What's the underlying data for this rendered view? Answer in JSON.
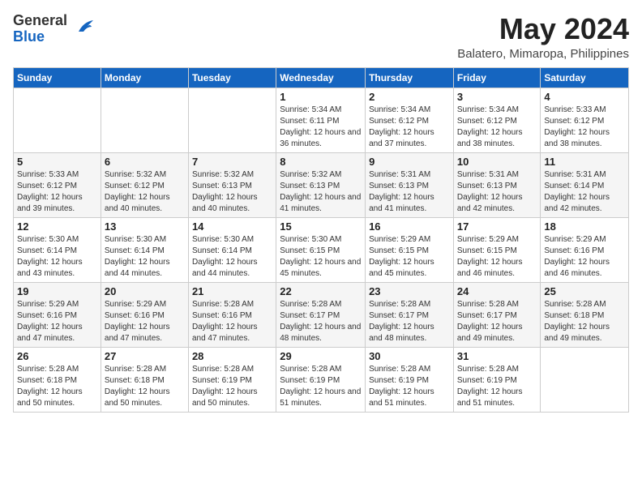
{
  "logo": {
    "general": "General",
    "blue": "Blue"
  },
  "title": "May 2024",
  "location": "Balatero, Mimaropa, Philippines",
  "days_of_week": [
    "Sunday",
    "Monday",
    "Tuesday",
    "Wednesday",
    "Thursday",
    "Friday",
    "Saturday"
  ],
  "weeks": [
    [
      {
        "day": "",
        "sunrise": "",
        "sunset": "",
        "daylight": ""
      },
      {
        "day": "",
        "sunrise": "",
        "sunset": "",
        "daylight": ""
      },
      {
        "day": "",
        "sunrise": "",
        "sunset": "",
        "daylight": ""
      },
      {
        "day": "1",
        "sunrise": "Sunrise: 5:34 AM",
        "sunset": "Sunset: 6:11 PM",
        "daylight": "Daylight: 12 hours and 36 minutes."
      },
      {
        "day": "2",
        "sunrise": "Sunrise: 5:34 AM",
        "sunset": "Sunset: 6:12 PM",
        "daylight": "Daylight: 12 hours and 37 minutes."
      },
      {
        "day": "3",
        "sunrise": "Sunrise: 5:34 AM",
        "sunset": "Sunset: 6:12 PM",
        "daylight": "Daylight: 12 hours and 38 minutes."
      },
      {
        "day": "4",
        "sunrise": "Sunrise: 5:33 AM",
        "sunset": "Sunset: 6:12 PM",
        "daylight": "Daylight: 12 hours and 38 minutes."
      }
    ],
    [
      {
        "day": "5",
        "sunrise": "Sunrise: 5:33 AM",
        "sunset": "Sunset: 6:12 PM",
        "daylight": "Daylight: 12 hours and 39 minutes."
      },
      {
        "day": "6",
        "sunrise": "Sunrise: 5:32 AM",
        "sunset": "Sunset: 6:12 PM",
        "daylight": "Daylight: 12 hours and 40 minutes."
      },
      {
        "day": "7",
        "sunrise": "Sunrise: 5:32 AM",
        "sunset": "Sunset: 6:13 PM",
        "daylight": "Daylight: 12 hours and 40 minutes."
      },
      {
        "day": "8",
        "sunrise": "Sunrise: 5:32 AM",
        "sunset": "Sunset: 6:13 PM",
        "daylight": "Daylight: 12 hours and 41 minutes."
      },
      {
        "day": "9",
        "sunrise": "Sunrise: 5:31 AM",
        "sunset": "Sunset: 6:13 PM",
        "daylight": "Daylight: 12 hours and 41 minutes."
      },
      {
        "day": "10",
        "sunrise": "Sunrise: 5:31 AM",
        "sunset": "Sunset: 6:13 PM",
        "daylight": "Daylight: 12 hours and 42 minutes."
      },
      {
        "day": "11",
        "sunrise": "Sunrise: 5:31 AM",
        "sunset": "Sunset: 6:14 PM",
        "daylight": "Daylight: 12 hours and 42 minutes."
      }
    ],
    [
      {
        "day": "12",
        "sunrise": "Sunrise: 5:30 AM",
        "sunset": "Sunset: 6:14 PM",
        "daylight": "Daylight: 12 hours and 43 minutes."
      },
      {
        "day": "13",
        "sunrise": "Sunrise: 5:30 AM",
        "sunset": "Sunset: 6:14 PM",
        "daylight": "Daylight: 12 hours and 44 minutes."
      },
      {
        "day": "14",
        "sunrise": "Sunrise: 5:30 AM",
        "sunset": "Sunset: 6:14 PM",
        "daylight": "Daylight: 12 hours and 44 minutes."
      },
      {
        "day": "15",
        "sunrise": "Sunrise: 5:30 AM",
        "sunset": "Sunset: 6:15 PM",
        "daylight": "Daylight: 12 hours and 45 minutes."
      },
      {
        "day": "16",
        "sunrise": "Sunrise: 5:29 AM",
        "sunset": "Sunset: 6:15 PM",
        "daylight": "Daylight: 12 hours and 45 minutes."
      },
      {
        "day": "17",
        "sunrise": "Sunrise: 5:29 AM",
        "sunset": "Sunset: 6:15 PM",
        "daylight": "Daylight: 12 hours and 46 minutes."
      },
      {
        "day": "18",
        "sunrise": "Sunrise: 5:29 AM",
        "sunset": "Sunset: 6:16 PM",
        "daylight": "Daylight: 12 hours and 46 minutes."
      }
    ],
    [
      {
        "day": "19",
        "sunrise": "Sunrise: 5:29 AM",
        "sunset": "Sunset: 6:16 PM",
        "daylight": "Daylight: 12 hours and 47 minutes."
      },
      {
        "day": "20",
        "sunrise": "Sunrise: 5:29 AM",
        "sunset": "Sunset: 6:16 PM",
        "daylight": "Daylight: 12 hours and 47 minutes."
      },
      {
        "day": "21",
        "sunrise": "Sunrise: 5:28 AM",
        "sunset": "Sunset: 6:16 PM",
        "daylight": "Daylight: 12 hours and 47 minutes."
      },
      {
        "day": "22",
        "sunrise": "Sunrise: 5:28 AM",
        "sunset": "Sunset: 6:17 PM",
        "daylight": "Daylight: 12 hours and 48 minutes."
      },
      {
        "day": "23",
        "sunrise": "Sunrise: 5:28 AM",
        "sunset": "Sunset: 6:17 PM",
        "daylight": "Daylight: 12 hours and 48 minutes."
      },
      {
        "day": "24",
        "sunrise": "Sunrise: 5:28 AM",
        "sunset": "Sunset: 6:17 PM",
        "daylight": "Daylight: 12 hours and 49 minutes."
      },
      {
        "day": "25",
        "sunrise": "Sunrise: 5:28 AM",
        "sunset": "Sunset: 6:18 PM",
        "daylight": "Daylight: 12 hours and 49 minutes."
      }
    ],
    [
      {
        "day": "26",
        "sunrise": "Sunrise: 5:28 AM",
        "sunset": "Sunset: 6:18 PM",
        "daylight": "Daylight: 12 hours and 50 minutes."
      },
      {
        "day": "27",
        "sunrise": "Sunrise: 5:28 AM",
        "sunset": "Sunset: 6:18 PM",
        "daylight": "Daylight: 12 hours and 50 minutes."
      },
      {
        "day": "28",
        "sunrise": "Sunrise: 5:28 AM",
        "sunset": "Sunset: 6:19 PM",
        "daylight": "Daylight: 12 hours and 50 minutes."
      },
      {
        "day": "29",
        "sunrise": "Sunrise: 5:28 AM",
        "sunset": "Sunset: 6:19 PM",
        "daylight": "Daylight: 12 hours and 51 minutes."
      },
      {
        "day": "30",
        "sunrise": "Sunrise: 5:28 AM",
        "sunset": "Sunset: 6:19 PM",
        "daylight": "Daylight: 12 hours and 51 minutes."
      },
      {
        "day": "31",
        "sunrise": "Sunrise: 5:28 AM",
        "sunset": "Sunset: 6:19 PM",
        "daylight": "Daylight: 12 hours and 51 minutes."
      },
      {
        "day": "",
        "sunrise": "",
        "sunset": "",
        "daylight": ""
      }
    ]
  ]
}
